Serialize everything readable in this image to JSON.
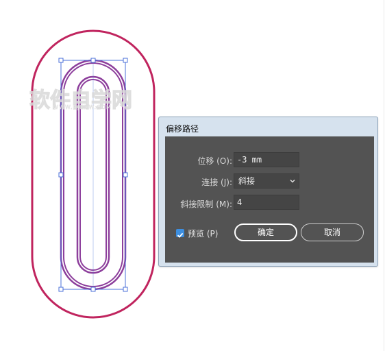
{
  "watermark": {
    "main": "软件自学网",
    "sub": "WWW.RJZXW.COM"
  },
  "colors": {
    "outer_path": "#c0245e",
    "inner_path": "#8d3f9c",
    "selection": "#4a6fd8",
    "dialog_panel": "#535353",
    "dialog_frame": "#d6e2ee",
    "checkbox": "#3d8fe0"
  },
  "dialog": {
    "title": "偏移路径",
    "offset": {
      "label": "位移 (O):",
      "value": "-3 mm"
    },
    "joins": {
      "label": "连接 (J):",
      "value": "斜接"
    },
    "miter_limit": {
      "label": "斜接限制 (M):",
      "value": "4"
    },
    "preview": {
      "label": "预览 (P)",
      "checked": true,
      "icon": "checkmark-icon"
    },
    "ok_label": "确定",
    "cancel_label": "取消"
  }
}
